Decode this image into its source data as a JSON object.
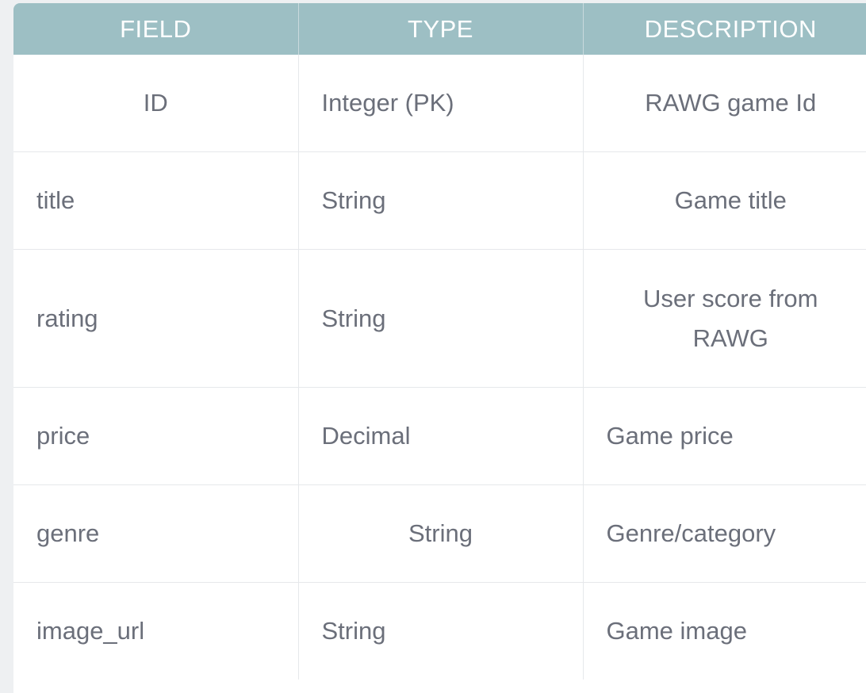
{
  "table": {
    "headers": [
      "FIELD",
      "TYPE",
      "DESCRIPTION"
    ],
    "rows": [
      {
        "field": "ID",
        "type": "Integer (PK)",
        "description": "RAWG game Id"
      },
      {
        "field": "title",
        "type": "String",
        "description": "Game title"
      },
      {
        "field": "rating",
        "type": "String",
        "description": "User score from RAWG"
      },
      {
        "field": "price",
        "type": "Decimal",
        "description": "Game price"
      },
      {
        "field": "genre",
        "type": "String",
        "description": "Genre/category"
      },
      {
        "field": "image_url",
        "type": "String",
        "description": "Game image"
      }
    ]
  },
  "colors": {
    "header_bg": "#9dbfc4",
    "header_text": "#ffffff",
    "cell_text": "#6b6f7a",
    "border": "#e6e8eb"
  }
}
